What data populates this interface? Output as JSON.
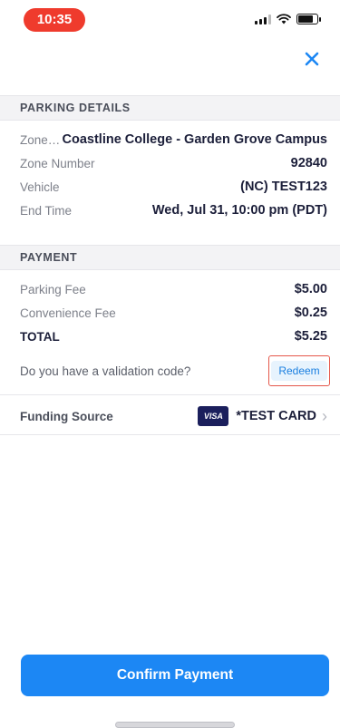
{
  "status_bar": {
    "time": "10:35"
  },
  "parking_details": {
    "header": "PARKING DETAILS",
    "zone_name_label": "Zone N...",
    "zone_name": "Coastline College - Garden Grove Campus",
    "zone_number_label": "Zone Number",
    "zone_number": "92840",
    "vehicle_label": "Vehicle",
    "vehicle": "(NC) TEST123",
    "end_time_label": "End Time",
    "end_time": "Wed, Jul 31, 10:00 pm (PDT)"
  },
  "payment": {
    "header": "PAYMENT",
    "parking_fee_label": "Parking Fee",
    "parking_fee": "$5.00",
    "convenience_fee_label": "Convenience Fee",
    "convenience_fee": "$0.25",
    "total_label": "TOTAL",
    "total": "$5.25",
    "validation_question": "Do you have a validation code?",
    "redeem_label": "Redeem"
  },
  "funding": {
    "label": "Funding Source",
    "card_brand": "VISA",
    "card_name": "*TEST CARD"
  },
  "confirm_label": "Confirm Payment",
  "colors": {
    "accent": "#1c87f4",
    "time_pill": "#ef3b2d",
    "highlight_border": "#e5574a"
  },
  "icons": {
    "close": "close-icon",
    "chevron": "chevron-right-icon"
  }
}
